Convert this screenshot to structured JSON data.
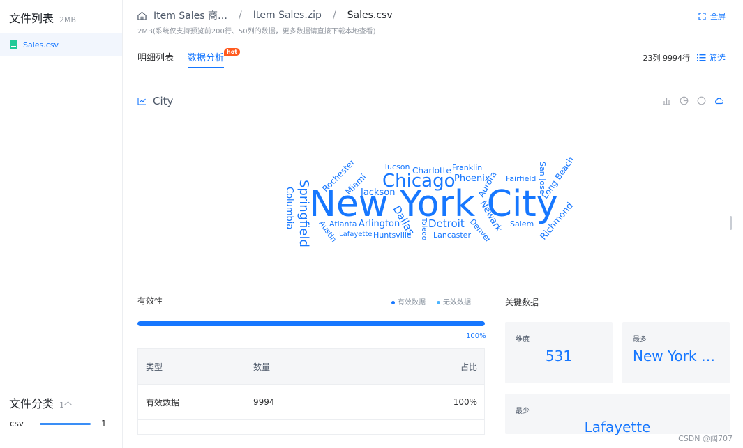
{
  "sidebar": {
    "title": "文件列表",
    "size": "2MB",
    "files": [
      {
        "name": "Sales.csv"
      }
    ],
    "category_title": "文件分类",
    "category_count": "1个",
    "categories": [
      {
        "name": "csv",
        "count": "1"
      }
    ]
  },
  "header": {
    "breadcrumb": [
      "Item Sales 商…",
      "Item Sales.zip",
      "Sales.csv"
    ],
    "fullscreen": "全屏",
    "note": "2MB(系统仅支持预览前200行、50列的数据，更多数据请直接下载本地查看)"
  },
  "tabs": [
    {
      "label": "明细列表"
    },
    {
      "label": "数据分析",
      "badge": "hot"
    }
  ],
  "meta": {
    "rows_cols": "23列 9994行",
    "filter": "筛选"
  },
  "section": {
    "title": "City"
  },
  "wordcloud": [
    "New York City",
    "Chicago",
    "Springfield",
    "Columbia",
    "Rochester",
    "Miami",
    "Jackson",
    "Tucson",
    "Charlotte",
    "Franklin",
    "Phoenix",
    "Aurora",
    "Fairfield",
    "San Jose",
    "Long Beach",
    "Dallas",
    "Atlanta",
    "Arlington",
    "Detroit",
    "Newark",
    "Denver",
    "Salem",
    "Richmond",
    "Austin",
    "Lafayette",
    "Huntsville",
    "Toledo",
    "Lancaster"
  ],
  "validity": {
    "title": "有效性",
    "legend": [
      {
        "label": "有效数据",
        "color": "#1677ff"
      },
      {
        "label": "无效数据",
        "color": "#4cb4ff"
      }
    ],
    "progress": 1.0,
    "progress_label": "100%",
    "table": {
      "headers": [
        "类型",
        "数量",
        "占比"
      ],
      "rows": [
        [
          "有效数据",
          "9994",
          "100%"
        ]
      ]
    }
  },
  "key_data": {
    "title": "关键数据",
    "dimension_label": "维度",
    "dimension_value": "531",
    "most_label": "最多",
    "most_value": "New York …",
    "least_label": "最少",
    "least_value": "Lafayette"
  },
  "watermark": "CSDN @阔707"
}
